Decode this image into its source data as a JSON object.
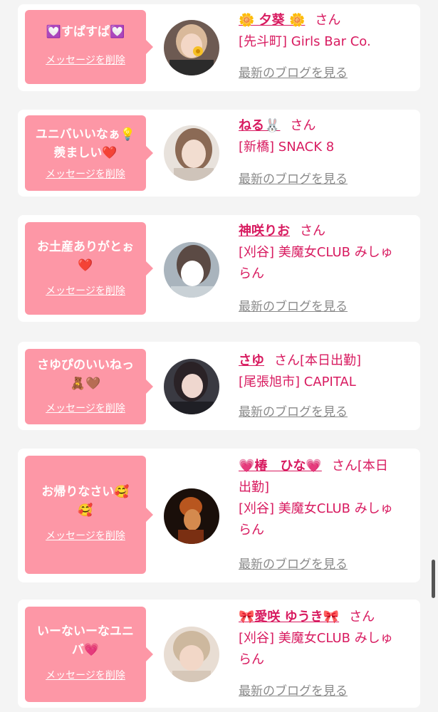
{
  "delete_label": "メッセージを削除",
  "blog_label": "最新のブログを見る",
  "san_label": "さん",
  "cards": [
    {
      "message_l1": "💟すぱすぱ💟",
      "message_l2": "",
      "name": "🌼 夕葵 🌼",
      "extra": "",
      "shop_l1": "[先斗町] Girls Bar Co.",
      "shop_l2": ""
    },
    {
      "message_l1": "ユニバいいなぁ💡",
      "message_l2": "羨ましい❤️",
      "name": "ねる🐰",
      "extra": "",
      "shop_l1": "[新橋] SNACK 8",
      "shop_l2": ""
    },
    {
      "message_l1": "お土産ありがとぉ",
      "message_l2": "❤️",
      "name": "神咲りお",
      "extra": "",
      "shop_l1": "[刈谷] 美魔女CLUB みしゅ",
      "shop_l2": "らん"
    },
    {
      "message_l1": "さゆぴのいいねっ",
      "message_l2": "🧸🤎",
      "name": "さゆ",
      "extra": "[本日出勤]",
      "shop_l1": "[尾張旭市] CAPITAL",
      "shop_l2": ""
    },
    {
      "message_l1": "お帰りなさい🥰",
      "message_l2": "🥰",
      "name": "💗椿　ひな💗",
      "extra": "[本日",
      "extra_l2": "出勤]",
      "shop_l1": "[刈谷] 美魔女CLUB みしゅ",
      "shop_l2": "らん"
    },
    {
      "message_l1": "いーないーなユニ",
      "message_l2": "バ💗",
      "name": "🎀愛咲 ゆうき🎀",
      "extra": "",
      "shop_l1": "[刈谷] 美魔女CLUB みしゅ",
      "shop_l2": "らん"
    }
  ]
}
